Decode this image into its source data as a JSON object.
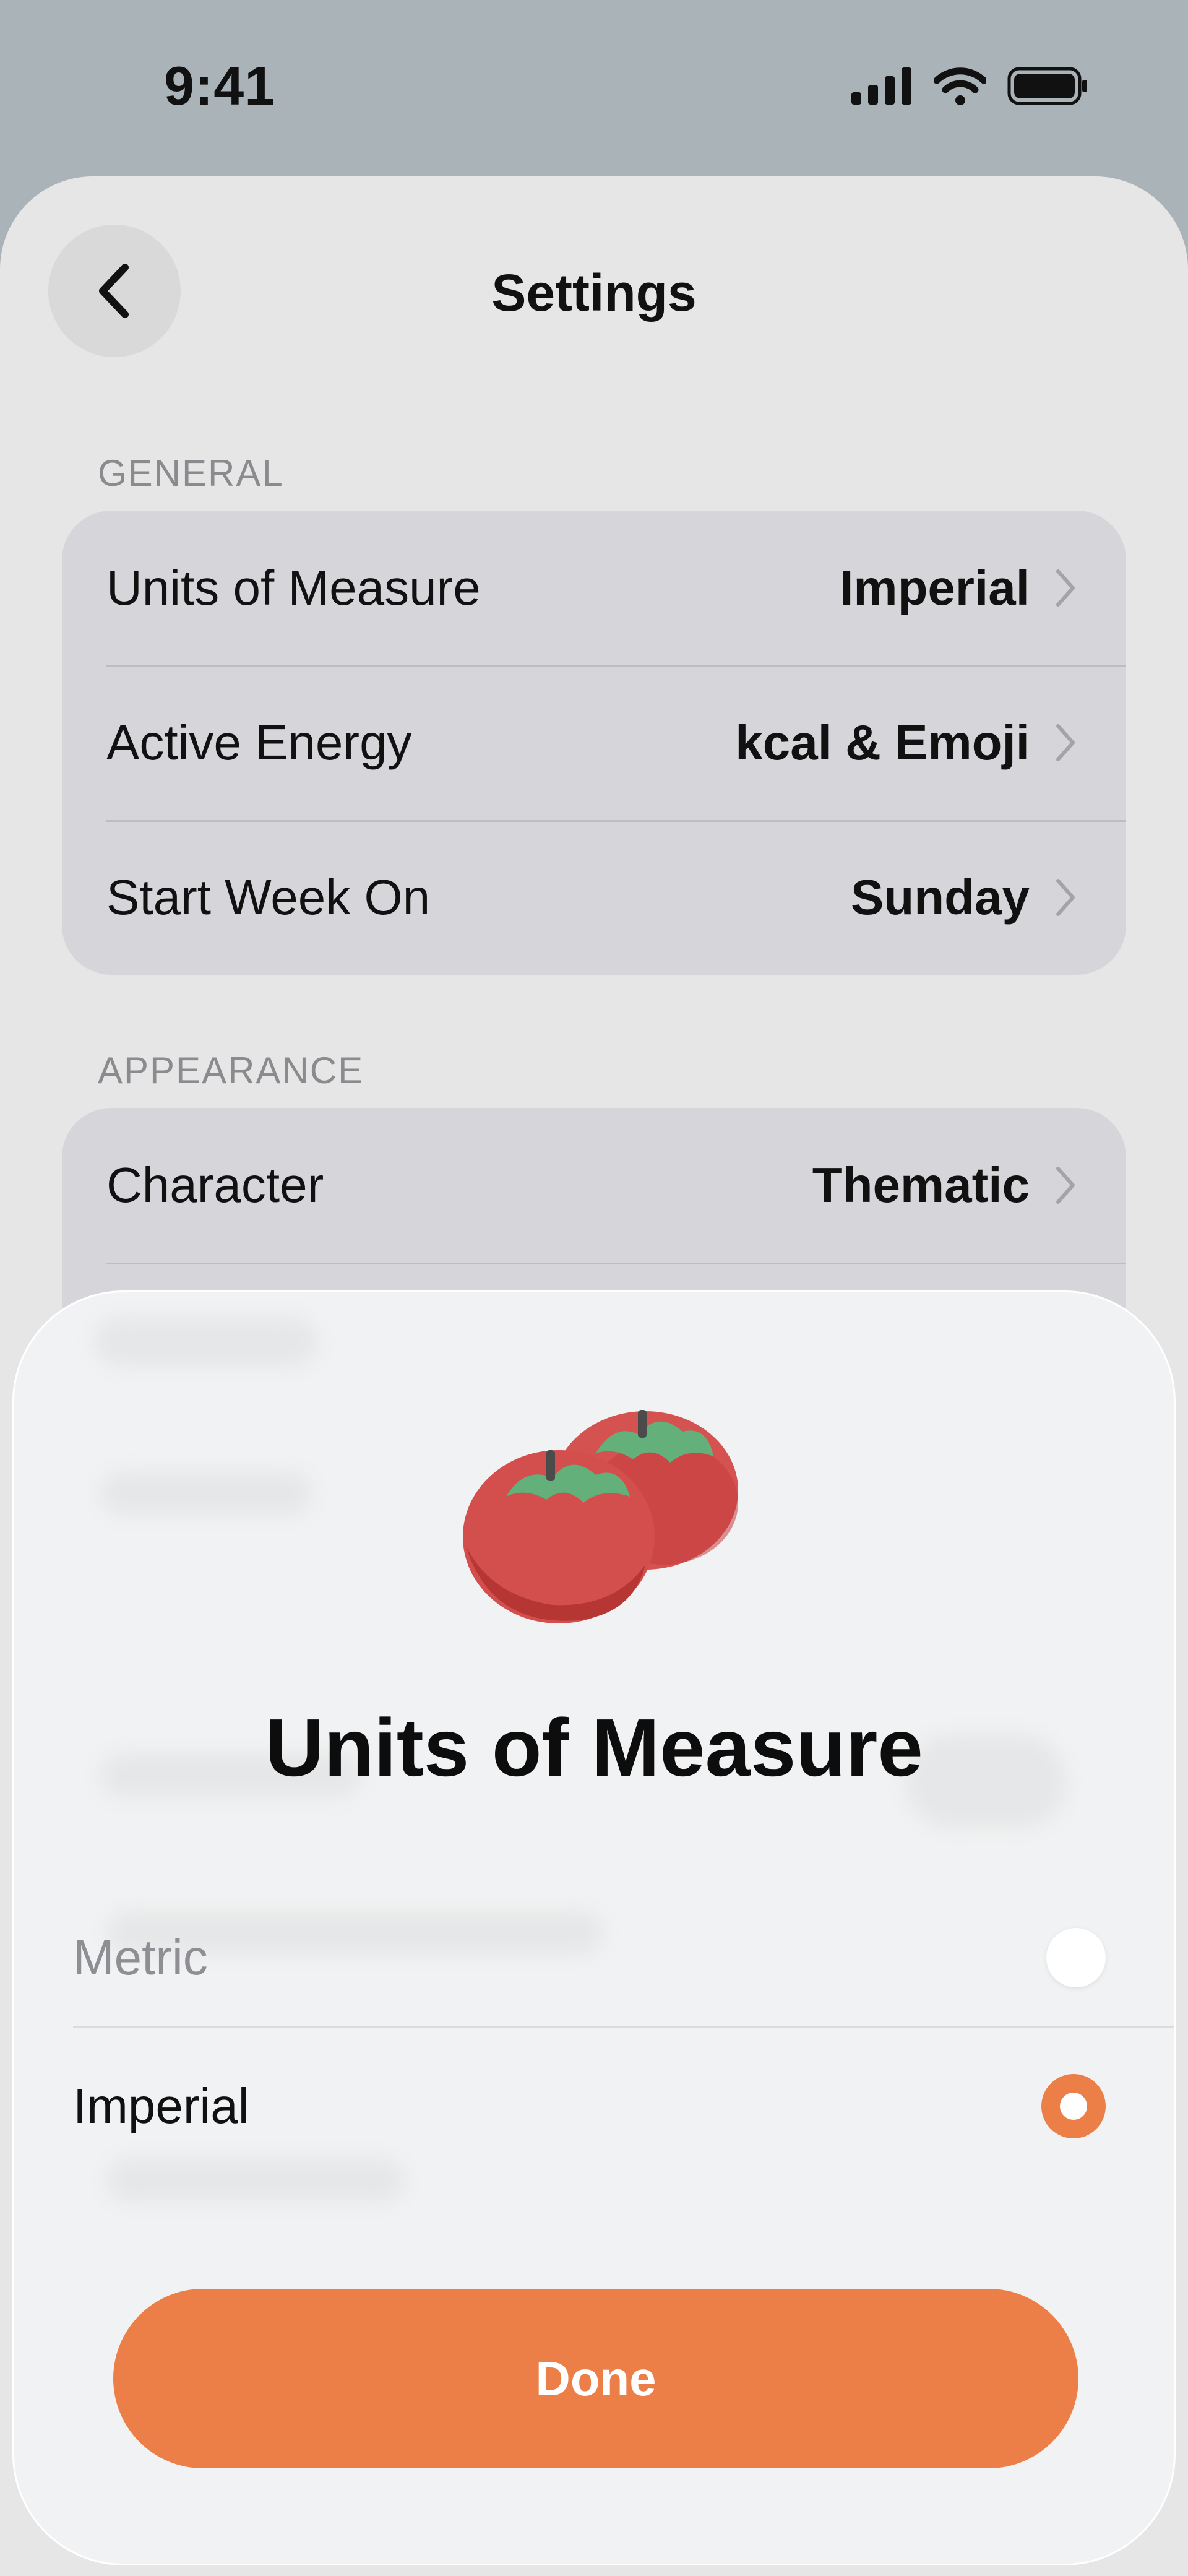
{
  "status_bar": {
    "time": "9:41"
  },
  "header": {
    "title": "Settings"
  },
  "sections": {
    "general": {
      "label": "GENERAL",
      "rows": [
        {
          "label": "Units of Measure",
          "value": "Imperial"
        },
        {
          "label": "Active Energy",
          "value": "kcal & Emoji"
        },
        {
          "label": "Start Week On",
          "value": "Sunday"
        }
      ]
    },
    "appearance": {
      "label": "APPEARANCE",
      "rows": [
        {
          "label": "Character",
          "value": "Thematic"
        }
      ]
    }
  },
  "modal": {
    "illustration_icon": "tomato-icon",
    "title": "Units of Measure",
    "options": [
      {
        "label": "Metric",
        "selected": false
      },
      {
        "label": "Imperial",
        "selected": true
      }
    ],
    "done_label": "Done"
  },
  "colors": {
    "accent": "#ec7f48",
    "background": "#a9b3b8",
    "sheet": "#e6e6e6",
    "modal": "#f1f2f3"
  }
}
